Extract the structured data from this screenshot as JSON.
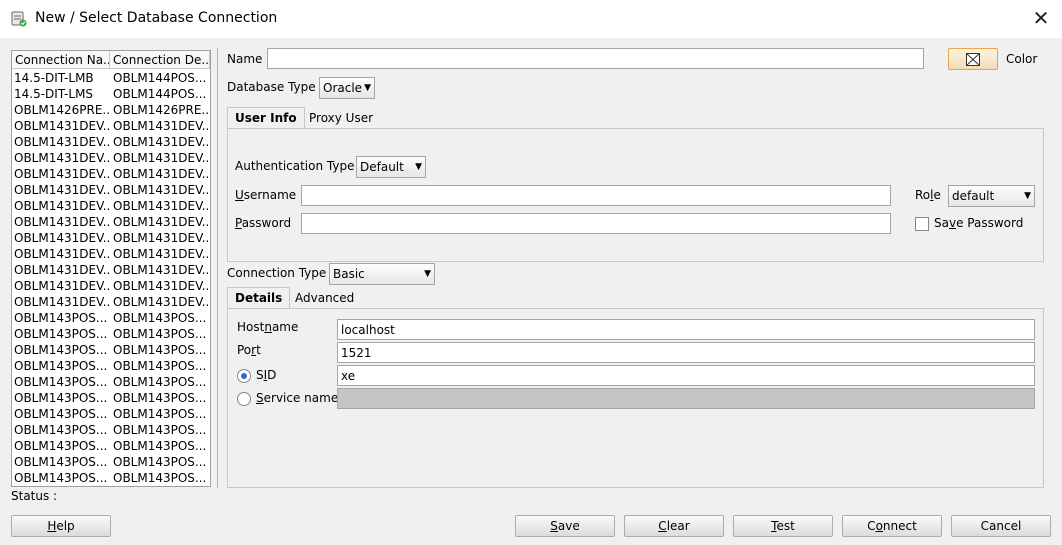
{
  "window": {
    "title": "New / Select Database Connection",
    "icon": "database-connection-icon",
    "close_icon": "close-icon"
  },
  "connections": {
    "columns": [
      "Connection Na...",
      "Connection De..."
    ],
    "rows": [
      [
        "14.5-DIT-LMB",
        "OBLM144POS..."
      ],
      [
        "14.5-DIT-LMS",
        "OBLM144POS..."
      ],
      [
        "OBLM1426PRE...",
        "OBLM1426PRE..."
      ],
      [
        "OBLM1431DEV...",
        "OBLM1431DEV..."
      ],
      [
        "OBLM1431DEV...",
        "OBLM1431DEV..."
      ],
      [
        "OBLM1431DEV...",
        "OBLM1431DEV..."
      ],
      [
        "OBLM1431DEV...",
        "OBLM1431DEV..."
      ],
      [
        "OBLM1431DEV...",
        "OBLM1431DEV..."
      ],
      [
        "OBLM1431DEV...",
        "OBLM1431DEV..."
      ],
      [
        "OBLM1431DEV...",
        "OBLM1431DEV..."
      ],
      [
        "OBLM1431DEV...",
        "OBLM1431DEV..."
      ],
      [
        "OBLM1431DEV...",
        "OBLM1431DEV..."
      ],
      [
        "OBLM1431DEV...",
        "OBLM1431DEV..."
      ],
      [
        "OBLM1431DEV...",
        "OBLM1431DEV..."
      ],
      [
        "OBLM1431DEV...",
        "OBLM1431DEV..."
      ],
      [
        "OBLM143POS...",
        "OBLM143POS..."
      ],
      [
        "OBLM143POS...",
        "OBLM143POS..."
      ],
      [
        "OBLM143POS...",
        "OBLM143POS..."
      ],
      [
        "OBLM143POS...",
        "OBLM143POS..."
      ],
      [
        "OBLM143POS...",
        "OBLM143POS..."
      ],
      [
        "OBLM143POS...",
        "OBLM143POS..."
      ],
      [
        "OBLM143POS...",
        "OBLM143POS..."
      ],
      [
        "OBLM143POS...",
        "OBLM143POS..."
      ],
      [
        "OBLM143POS...",
        "OBLM143POS..."
      ],
      [
        "OBLM143POS...",
        "OBLM143POS..."
      ],
      [
        "OBLM143POS...",
        "OBLM143POS..."
      ]
    ]
  },
  "form": {
    "name_label": "Name",
    "name_value": "",
    "color_label": "Color",
    "color_icon": "no-color-icon",
    "db_type_label": "Database Type",
    "db_type_value": "Oracle",
    "tabs": [
      "User Info",
      "Proxy User"
    ],
    "auth_type_label": "Authentication Type",
    "auth_type_value": "Default",
    "username_label": "Username",
    "username_value": "",
    "password_label": "Password",
    "password_value": "",
    "role_label": "Role",
    "role_value": "default",
    "save_password_label": "Save Password",
    "save_password_checked": false,
    "conn_type_label": "Connection Type",
    "conn_type_value": "Basic",
    "detail_tabs": [
      "Details",
      "Advanced"
    ],
    "hostname_label": "Hostname",
    "hostname_value": "localhost",
    "port_label": "Port",
    "port_value": "1521",
    "sid_label": "SID",
    "sid_value": "xe",
    "service_label": "Service name",
    "service_value": "",
    "selected_radio": "SID"
  },
  "status": {
    "label": "Status :"
  },
  "buttons": {
    "help": "Help",
    "save": "Save",
    "clear": "Clear",
    "test": "Test",
    "connect": "Connect",
    "cancel": "Cancel"
  },
  "colors": {
    "accent": "#2a6ecb",
    "color_button_border": "#e8a54c"
  }
}
